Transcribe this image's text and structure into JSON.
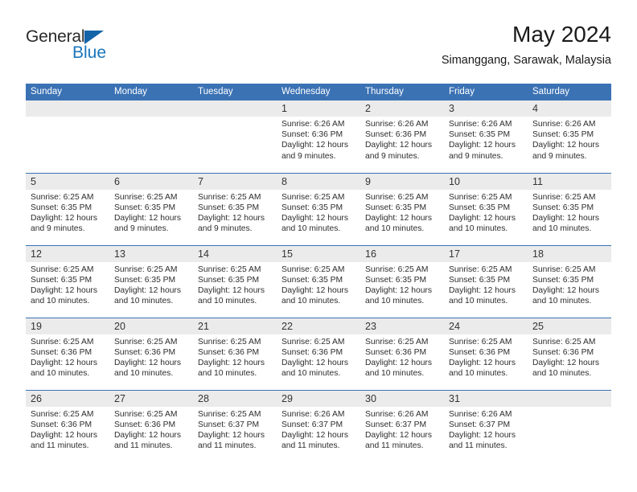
{
  "logo": {
    "primary_text": "General",
    "secondary_text": "Blue",
    "primary_color": "#2b2b2b",
    "secondary_color": "#1b75bb",
    "triangle_color": "#1464aa"
  },
  "header": {
    "title": "May 2024",
    "subtitle": "Simanggang, Sarawak, Malaysia"
  },
  "theme": {
    "header_bg": "#3b72b4",
    "header_text": "#ffffff",
    "daynum_bg": "#ebebeb",
    "row_divider": "#3b72b4",
    "body_text": "#2d2d2d"
  },
  "calendar": {
    "weekday_headers": [
      "Sunday",
      "Monday",
      "Tuesday",
      "Wednesday",
      "Thursday",
      "Friday",
      "Saturday"
    ],
    "weeks": [
      [
        {
          "day": "",
          "empty": true
        },
        {
          "day": "",
          "empty": true
        },
        {
          "day": "",
          "empty": true
        },
        {
          "day": "1",
          "sunrise": "Sunrise: 6:26 AM",
          "sunset": "Sunset: 6:36 PM",
          "daylight": "Daylight: 12 hours and 9 minutes."
        },
        {
          "day": "2",
          "sunrise": "Sunrise: 6:26 AM",
          "sunset": "Sunset: 6:36 PM",
          "daylight": "Daylight: 12 hours and 9 minutes."
        },
        {
          "day": "3",
          "sunrise": "Sunrise: 6:26 AM",
          "sunset": "Sunset: 6:35 PM",
          "daylight": "Daylight: 12 hours and 9 minutes."
        },
        {
          "day": "4",
          "sunrise": "Sunrise: 6:26 AM",
          "sunset": "Sunset: 6:35 PM",
          "daylight": "Daylight: 12 hours and 9 minutes."
        }
      ],
      [
        {
          "day": "5",
          "sunrise": "Sunrise: 6:25 AM",
          "sunset": "Sunset: 6:35 PM",
          "daylight": "Daylight: 12 hours and 9 minutes."
        },
        {
          "day": "6",
          "sunrise": "Sunrise: 6:25 AM",
          "sunset": "Sunset: 6:35 PM",
          "daylight": "Daylight: 12 hours and 9 minutes."
        },
        {
          "day": "7",
          "sunrise": "Sunrise: 6:25 AM",
          "sunset": "Sunset: 6:35 PM",
          "daylight": "Daylight: 12 hours and 9 minutes."
        },
        {
          "day": "8",
          "sunrise": "Sunrise: 6:25 AM",
          "sunset": "Sunset: 6:35 PM",
          "daylight": "Daylight: 12 hours and 10 minutes."
        },
        {
          "day": "9",
          "sunrise": "Sunrise: 6:25 AM",
          "sunset": "Sunset: 6:35 PM",
          "daylight": "Daylight: 12 hours and 10 minutes."
        },
        {
          "day": "10",
          "sunrise": "Sunrise: 6:25 AM",
          "sunset": "Sunset: 6:35 PM",
          "daylight": "Daylight: 12 hours and 10 minutes."
        },
        {
          "day": "11",
          "sunrise": "Sunrise: 6:25 AM",
          "sunset": "Sunset: 6:35 PM",
          "daylight": "Daylight: 12 hours and 10 minutes."
        }
      ],
      [
        {
          "day": "12",
          "sunrise": "Sunrise: 6:25 AM",
          "sunset": "Sunset: 6:35 PM",
          "daylight": "Daylight: 12 hours and 10 minutes."
        },
        {
          "day": "13",
          "sunrise": "Sunrise: 6:25 AM",
          "sunset": "Sunset: 6:35 PM",
          "daylight": "Daylight: 12 hours and 10 minutes."
        },
        {
          "day": "14",
          "sunrise": "Sunrise: 6:25 AM",
          "sunset": "Sunset: 6:35 PM",
          "daylight": "Daylight: 12 hours and 10 minutes."
        },
        {
          "day": "15",
          "sunrise": "Sunrise: 6:25 AM",
          "sunset": "Sunset: 6:35 PM",
          "daylight": "Daylight: 12 hours and 10 minutes."
        },
        {
          "day": "16",
          "sunrise": "Sunrise: 6:25 AM",
          "sunset": "Sunset: 6:35 PM",
          "daylight": "Daylight: 12 hours and 10 minutes."
        },
        {
          "day": "17",
          "sunrise": "Sunrise: 6:25 AM",
          "sunset": "Sunset: 6:35 PM",
          "daylight": "Daylight: 12 hours and 10 minutes."
        },
        {
          "day": "18",
          "sunrise": "Sunrise: 6:25 AM",
          "sunset": "Sunset: 6:35 PM",
          "daylight": "Daylight: 12 hours and 10 minutes."
        }
      ],
      [
        {
          "day": "19",
          "sunrise": "Sunrise: 6:25 AM",
          "sunset": "Sunset: 6:36 PM",
          "daylight": "Daylight: 12 hours and 10 minutes."
        },
        {
          "day": "20",
          "sunrise": "Sunrise: 6:25 AM",
          "sunset": "Sunset: 6:36 PM",
          "daylight": "Daylight: 12 hours and 10 minutes."
        },
        {
          "day": "21",
          "sunrise": "Sunrise: 6:25 AM",
          "sunset": "Sunset: 6:36 PM",
          "daylight": "Daylight: 12 hours and 10 minutes."
        },
        {
          "day": "22",
          "sunrise": "Sunrise: 6:25 AM",
          "sunset": "Sunset: 6:36 PM",
          "daylight": "Daylight: 12 hours and 10 minutes."
        },
        {
          "day": "23",
          "sunrise": "Sunrise: 6:25 AM",
          "sunset": "Sunset: 6:36 PM",
          "daylight": "Daylight: 12 hours and 10 minutes."
        },
        {
          "day": "24",
          "sunrise": "Sunrise: 6:25 AM",
          "sunset": "Sunset: 6:36 PM",
          "daylight": "Daylight: 12 hours and 10 minutes."
        },
        {
          "day": "25",
          "sunrise": "Sunrise: 6:25 AM",
          "sunset": "Sunset: 6:36 PM",
          "daylight": "Daylight: 12 hours and 10 minutes."
        }
      ],
      [
        {
          "day": "26",
          "sunrise": "Sunrise: 6:25 AM",
          "sunset": "Sunset: 6:36 PM",
          "daylight": "Daylight: 12 hours and 11 minutes."
        },
        {
          "day": "27",
          "sunrise": "Sunrise: 6:25 AM",
          "sunset": "Sunset: 6:36 PM",
          "daylight": "Daylight: 12 hours and 11 minutes."
        },
        {
          "day": "28",
          "sunrise": "Sunrise: 6:25 AM",
          "sunset": "Sunset: 6:37 PM",
          "daylight": "Daylight: 12 hours and 11 minutes."
        },
        {
          "day": "29",
          "sunrise": "Sunrise: 6:26 AM",
          "sunset": "Sunset: 6:37 PM",
          "daylight": "Daylight: 12 hours and 11 minutes."
        },
        {
          "day": "30",
          "sunrise": "Sunrise: 6:26 AM",
          "sunset": "Sunset: 6:37 PM",
          "daylight": "Daylight: 12 hours and 11 minutes."
        },
        {
          "day": "31",
          "sunrise": "Sunrise: 6:26 AM",
          "sunset": "Sunset: 6:37 PM",
          "daylight": "Daylight: 12 hours and 11 minutes."
        },
        {
          "day": "",
          "empty": true
        }
      ]
    ]
  }
}
